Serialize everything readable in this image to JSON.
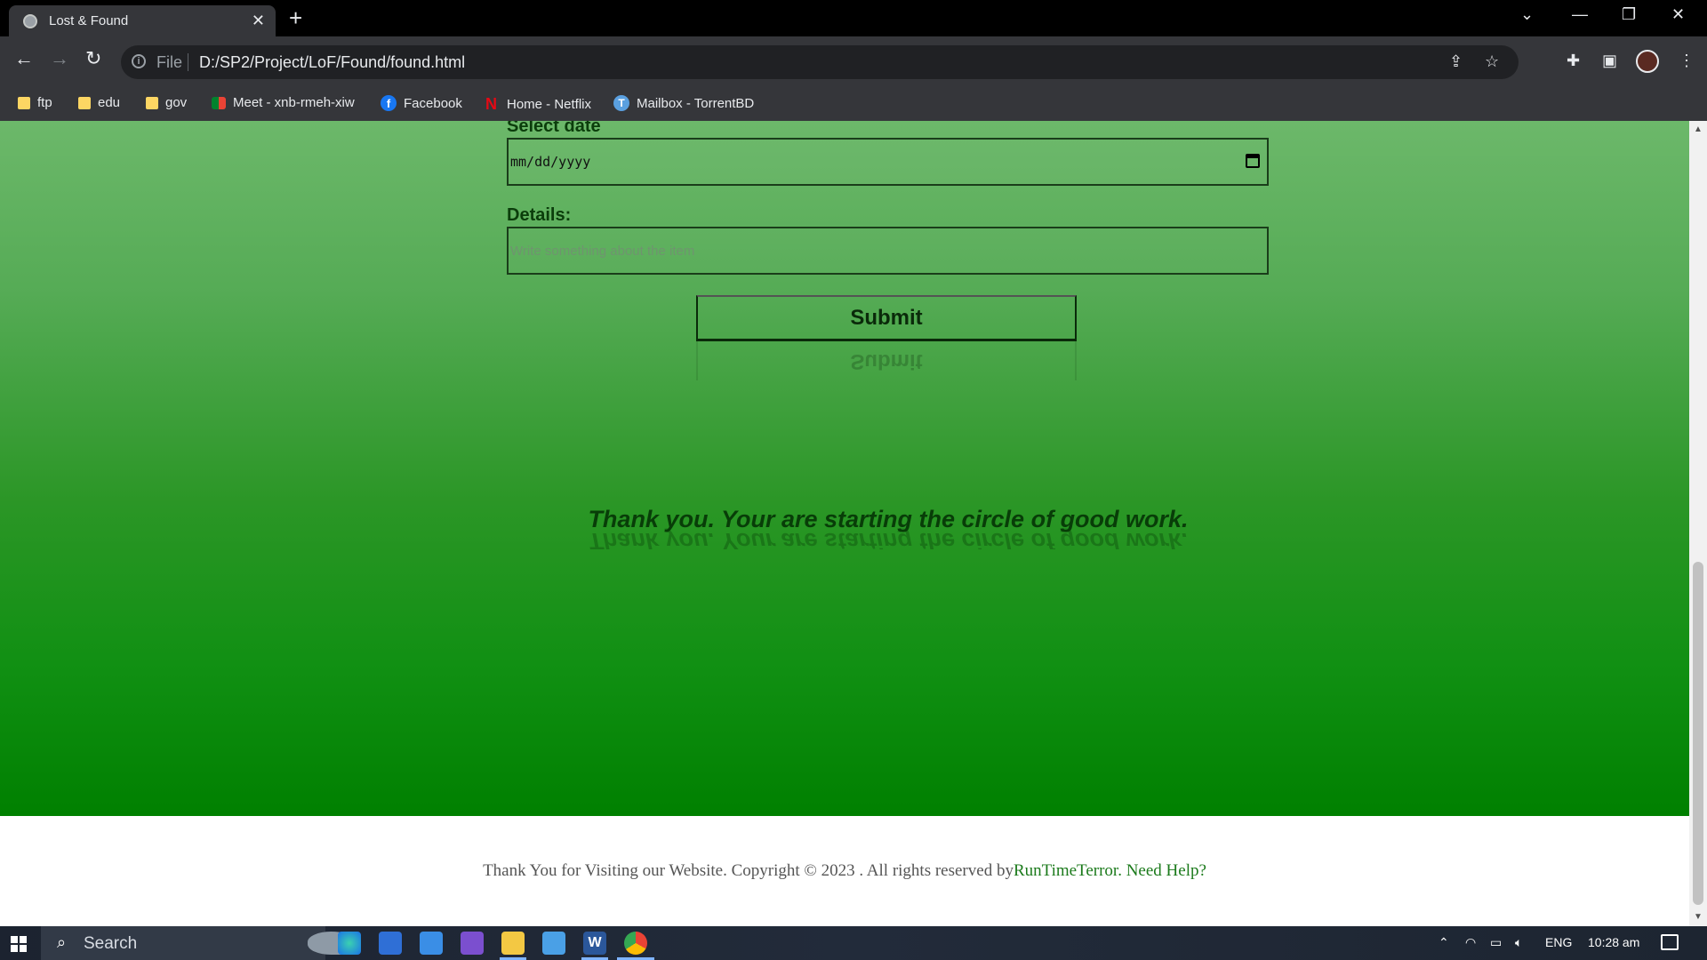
{
  "browser": {
    "tab_title": "Lost & Found",
    "file_label": "File",
    "url": "D:/SP2/Project/LoF/Found/found.html"
  },
  "bookmarks": [
    {
      "label": "ftp",
      "icon": "folder-icon"
    },
    {
      "label": "edu",
      "icon": "folder-icon"
    },
    {
      "label": "gov",
      "icon": "folder-icon"
    },
    {
      "label": "Meet - xnb-rmeh-xiw",
      "icon": "google-meet-icon"
    },
    {
      "label": "Facebook",
      "icon": "facebook-icon"
    },
    {
      "label": "Home - Netflix",
      "icon": "netflix-icon"
    },
    {
      "label": "Mailbox - TorrentBD",
      "icon": "torrentbd-icon"
    }
  ],
  "form": {
    "date_label": "Select date",
    "date_placeholder": "mm/dd/yyyy",
    "details_label": "Details:",
    "details_placeholder": "Write something about the item",
    "submit_label": "Submit"
  },
  "thank_you": "Thank you. Your are starting the circle of good work.",
  "footer": {
    "text": "Thank You for Visiting our Website. Copyright © 2023 . All rights reserved by",
    "brand_link": "RunTimeTerror.",
    "help_link": "Need Help?"
  },
  "taskbar": {
    "search_placeholder": "Search",
    "language": "ENG",
    "time": "10:28 am"
  },
  "colors": {
    "green_top": "#6cb86a",
    "green_bottom": "#008000",
    "link_green": "#1b7a1b"
  }
}
